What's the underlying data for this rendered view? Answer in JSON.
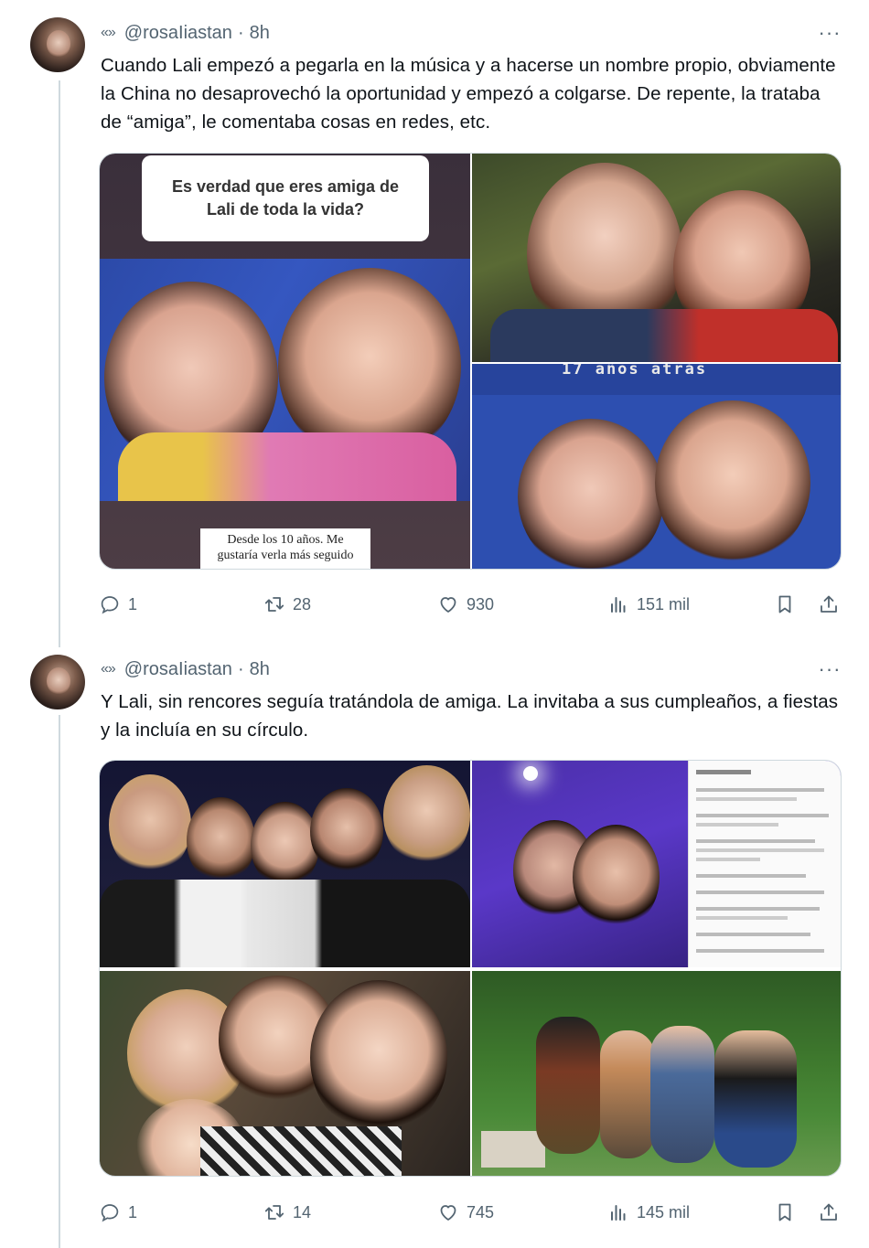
{
  "tweets": [
    {
      "handle_icon": "«»",
      "handle": "@rosaIiastan",
      "separator": "·",
      "time": "8h",
      "more_icon": "more-dots-icon",
      "more_label": "···",
      "text": "Cuando Lali empezó a pegarla en la música y a hacerse un nombre propio, obviamente la China no desaprovechó la oportunidad y empezó a colgarse. De repente, la trataba de “amiga”, le comentaba cosas en redes, etc.",
      "media": {
        "story_question": "Es verdad que eres amiga de Lali de toda la vida?",
        "story_answer": "Desde los 10 años. Me gustaría verla más seguido",
        "overlay_caption": "17 años atrás"
      },
      "actions": {
        "replies": "1",
        "retweets": "28",
        "likes": "930",
        "views": "151 mil"
      }
    },
    {
      "handle_icon": "«»",
      "handle": "@rosaIiastan",
      "separator": "·",
      "time": "8h",
      "more_icon": "more-dots-icon",
      "more_label": "···",
      "text": "Y Lali, sin rencores seguía tratándola de amiga. La invitaba a sus cumpleaños, a fiestas y la incluía en su círculo.",
      "actions": {
        "replies": "1",
        "retweets": "14",
        "likes": "745",
        "views": "145 mil"
      }
    }
  ],
  "colors": {
    "text": "#0f1419",
    "secondary": "#536471",
    "border": "#cfd9de"
  }
}
